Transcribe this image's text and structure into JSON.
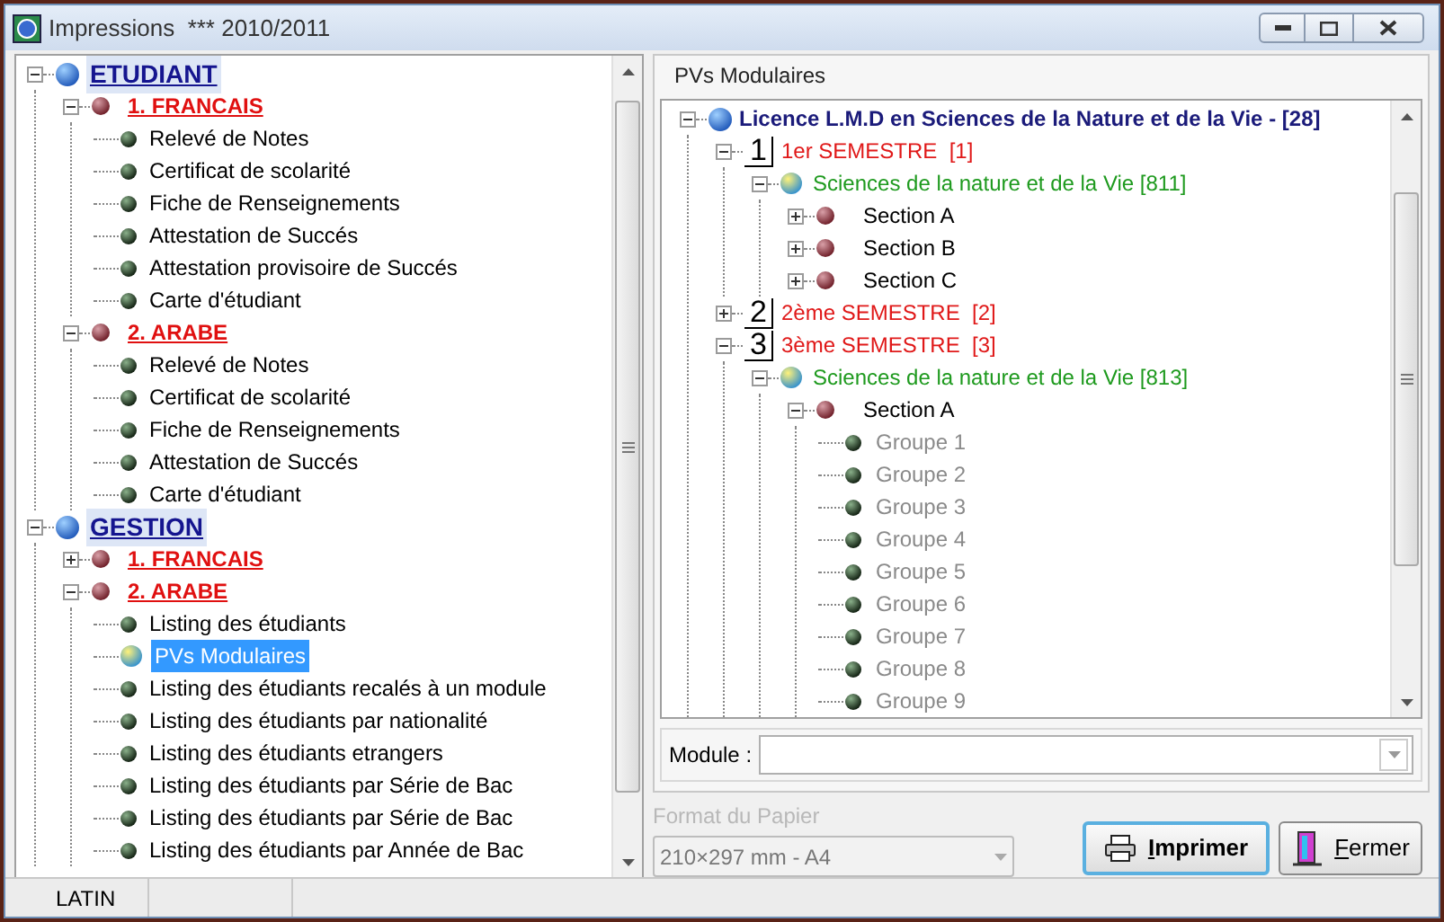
{
  "window": {
    "title": "Impressions",
    "subtitle": "*** 2010/2011"
  },
  "report_tree": [
    {
      "kind": "root",
      "label": "ETUDIANT",
      "expanded": true,
      "children": [
        {
          "kind": "category",
          "label": "1. FRANCAIS",
          "expanded": true,
          "children": [
            {
              "kind": "leaf",
              "label": "Relevé de Notes",
              "selected": false
            },
            {
              "kind": "leaf",
              "label": "Certificat de scolarité",
              "selected": false
            },
            {
              "kind": "leaf",
              "label": "Fiche de Renseignements",
              "selected": false
            },
            {
              "kind": "leaf",
              "label": "Attestation de Succés",
              "selected": false
            },
            {
              "kind": "leaf",
              "label": "Attestation provisoire de Succés",
              "selected": false
            },
            {
              "kind": "leaf",
              "label": "Carte d'étudiant",
              "selected": false
            }
          ]
        },
        {
          "kind": "category",
          "label": "2. ARABE",
          "expanded": true,
          "children": [
            {
              "kind": "leaf",
              "label": "Relevé de Notes",
              "selected": false
            },
            {
              "kind": "leaf",
              "label": "Certificat de scolarité",
              "selected": false
            },
            {
              "kind": "leaf",
              "label": "Fiche de Renseignements",
              "selected": false
            },
            {
              "kind": "leaf",
              "label": "Attestation de Succés",
              "selected": false
            },
            {
              "kind": "leaf",
              "label": "Carte d'étudiant",
              "selected": false
            }
          ]
        }
      ]
    },
    {
      "kind": "root",
      "label": "GESTION",
      "expanded": true,
      "children": [
        {
          "kind": "category",
          "label": "1. FRANCAIS",
          "expanded": false
        },
        {
          "kind": "category",
          "label": "2. ARABE",
          "expanded": true,
          "children": [
            {
              "kind": "leaf",
              "label": "Listing des étudiants",
              "selected": false
            },
            {
              "kind": "leaf",
              "label": "PVs Modulaires",
              "selected": true
            },
            {
              "kind": "leaf",
              "label": "Listing des étudiants recalés à un module",
              "selected": false
            },
            {
              "kind": "leaf",
              "label": "Listing des étudiants par nationalité",
              "selected": false
            },
            {
              "kind": "leaf",
              "label": "Listing des étudiants etrangers",
              "selected": false
            },
            {
              "kind": "leaf",
              "label": "Listing des étudiants par Série de Bac",
              "selected": false
            },
            {
              "kind": "leaf",
              "label": "Listing des étudiants par Série de Bac",
              "selected": false
            },
            {
              "kind": "leaf",
              "label": "Listing des étudiants par Année de Bac",
              "selected": false
            }
          ]
        }
      ]
    }
  ],
  "panel_title": "PVs Modulaires",
  "pv_tree": [
    {
      "kind": "root",
      "label": "Licence L.M.D en Sciences de la Nature et de la Vie - [28]",
      "expanded": true,
      "children": [
        {
          "kind": "semester",
          "number": "1",
          "label": "1er SEMESTRE  [1]",
          "expanded": true,
          "children": [
            {
              "kind": "module",
              "label": "Sciences de la nature et de la Vie [811]",
              "expanded": true,
              "children": [
                {
                  "kind": "section",
                  "label": "Section A",
                  "expanded": false
                },
                {
                  "kind": "section",
                  "label": "Section B",
                  "expanded": false
                },
                {
                  "kind": "section",
                  "label": "Section C",
                  "expanded": false
                }
              ]
            }
          ]
        },
        {
          "kind": "semester",
          "number": "2",
          "label": "2ème SEMESTRE  [2]",
          "expanded": false
        },
        {
          "kind": "semester",
          "number": "3",
          "label": "3ème SEMESTRE  [3]",
          "expanded": true,
          "children": [
            {
              "kind": "module",
              "label": "Sciences de la nature et de la Vie [813]",
              "expanded": true,
              "children": [
                {
                  "kind": "section",
                  "label": "Section A",
                  "expanded": true,
                  "children": [
                    {
                      "kind": "group",
                      "label": "Groupe 1"
                    },
                    {
                      "kind": "group",
                      "label": "Groupe 2"
                    },
                    {
                      "kind": "group",
                      "label": "Groupe 3"
                    },
                    {
                      "kind": "group",
                      "label": "Groupe 4"
                    },
                    {
                      "kind": "group",
                      "label": "Groupe 5"
                    },
                    {
                      "kind": "group",
                      "label": "Groupe 6"
                    },
                    {
                      "kind": "group",
                      "label": "Groupe 7"
                    },
                    {
                      "kind": "group",
                      "label": "Groupe 8"
                    },
                    {
                      "kind": "group",
                      "label": "Groupe 9"
                    }
                  ]
                }
              ]
            }
          ]
        }
      ]
    }
  ],
  "module": {
    "label": "Module :"
  },
  "paper_format": {
    "label": "Format du Papier",
    "value": "210×297 mm - A4",
    "disabled": true
  },
  "buttons": [
    {
      "kind": "print",
      "label": "Imprimer",
      "focused": true
    },
    {
      "kind": "close",
      "label": "Fermer",
      "focused": false
    }
  ],
  "status_bar": [
    "LATIN"
  ]
}
